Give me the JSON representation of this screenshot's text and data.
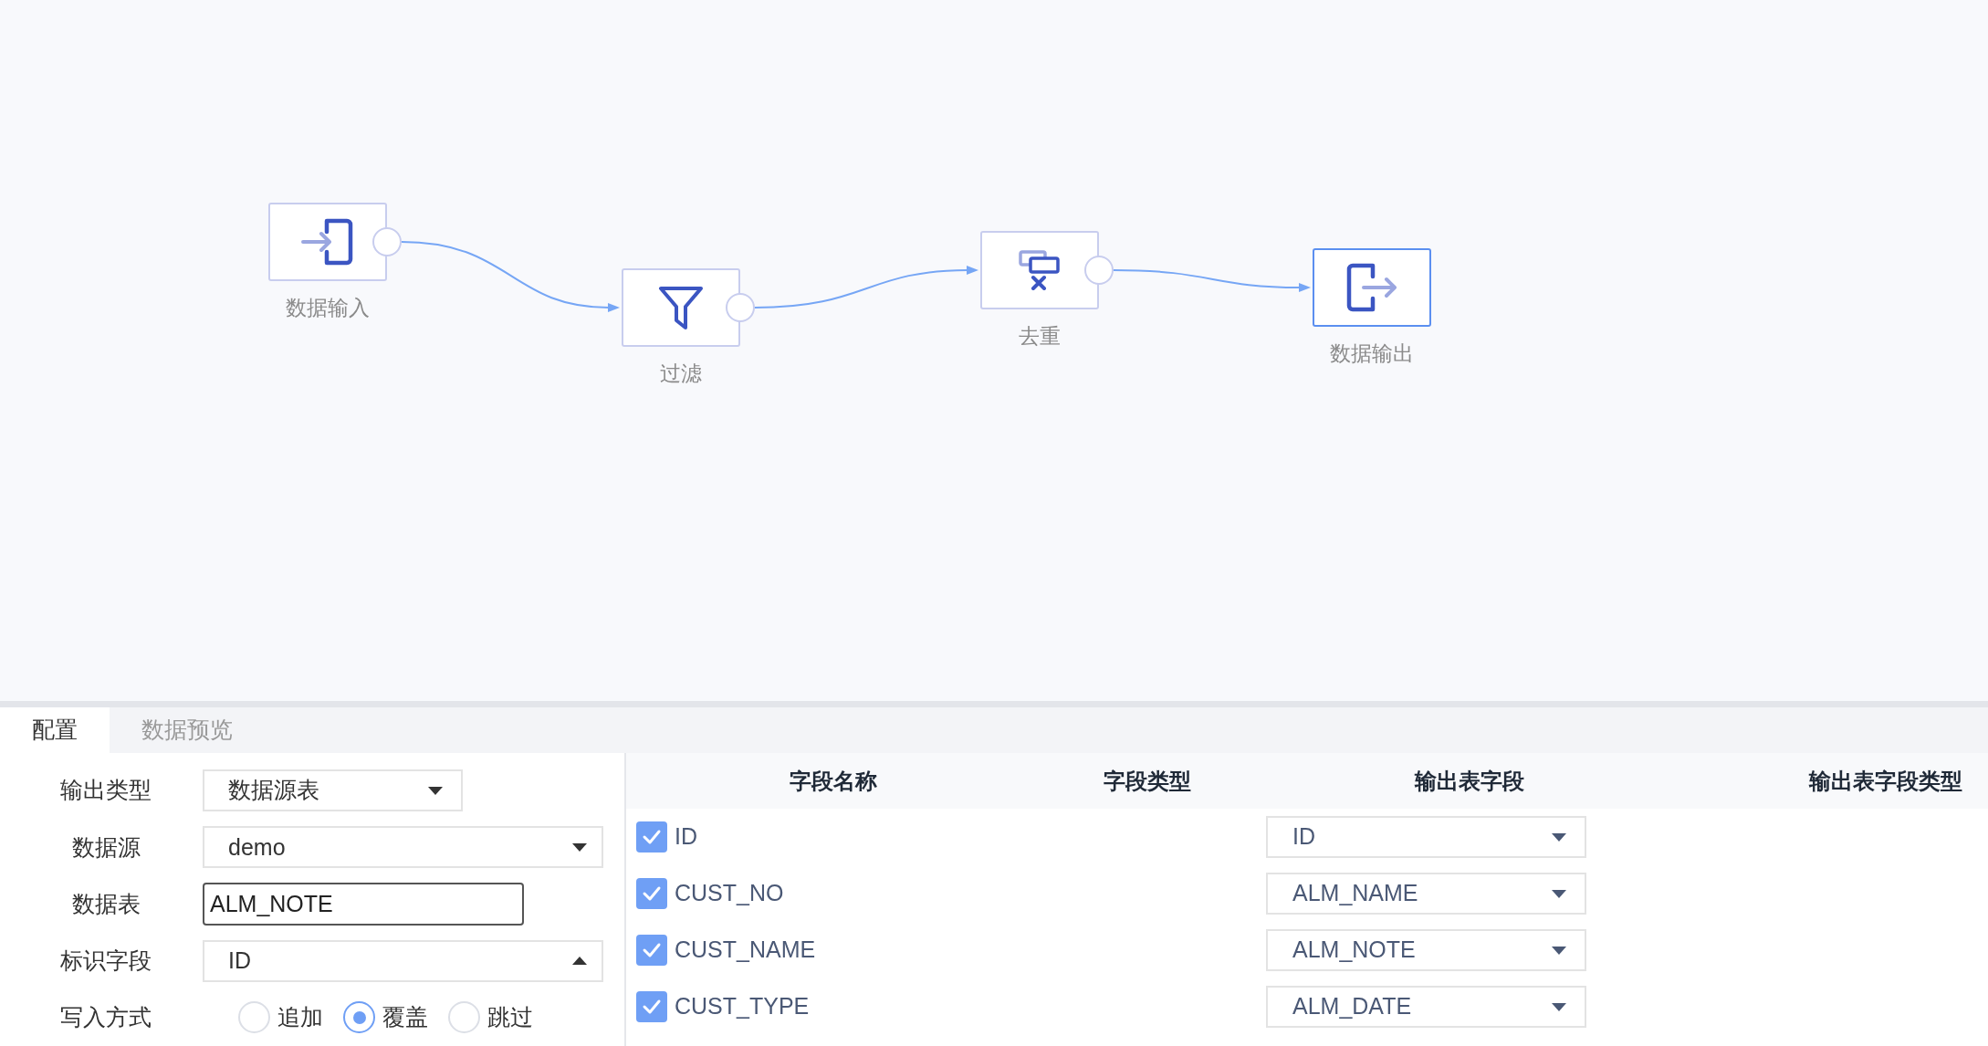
{
  "flow": {
    "nodes": [
      {
        "kind": "input",
        "label": "数据输入",
        "selected": false
      },
      {
        "kind": "filter",
        "label": "过滤",
        "selected": false
      },
      {
        "kind": "dedup",
        "label": "去重",
        "selected": false
      },
      {
        "kind": "output",
        "label": "数据输出",
        "selected": true
      }
    ]
  },
  "tabs": [
    {
      "label": "配置",
      "selected": true
    },
    {
      "label": "数据预览",
      "selected": false
    }
  ],
  "form": {
    "fields": [
      {
        "kind": "select",
        "label": "输出类型",
        "value": "数据源表",
        "expanded": false
      },
      {
        "kind": "select",
        "label": "数据源",
        "value": "demo",
        "expanded": false
      },
      {
        "kind": "input",
        "label": "数据表",
        "value": "ALM_NOTE"
      },
      {
        "kind": "select",
        "label": "标识字段",
        "value": "ID",
        "expanded": true
      },
      {
        "kind": "radio",
        "label": "写入方式",
        "options": [
          {
            "label": "追加",
            "selected": false
          },
          {
            "label": "覆盖",
            "selected": true
          },
          {
            "label": "跳过",
            "selected": false
          }
        ]
      }
    ]
  },
  "table": {
    "columns": [
      "字段名称",
      "字段类型",
      "输出表字段",
      "输出表字段类型"
    ],
    "rows": [
      {
        "checked": true,
        "name": "ID",
        "output_field": "ID"
      },
      {
        "checked": true,
        "name": "CUST_NO",
        "output_field": "ALM_NAME"
      },
      {
        "checked": true,
        "name": "CUST_NAME",
        "output_field": "ALM_NOTE"
      },
      {
        "checked": true,
        "name": "CUST_TYPE",
        "output_field": "ALM_DATE"
      }
    ]
  }
}
